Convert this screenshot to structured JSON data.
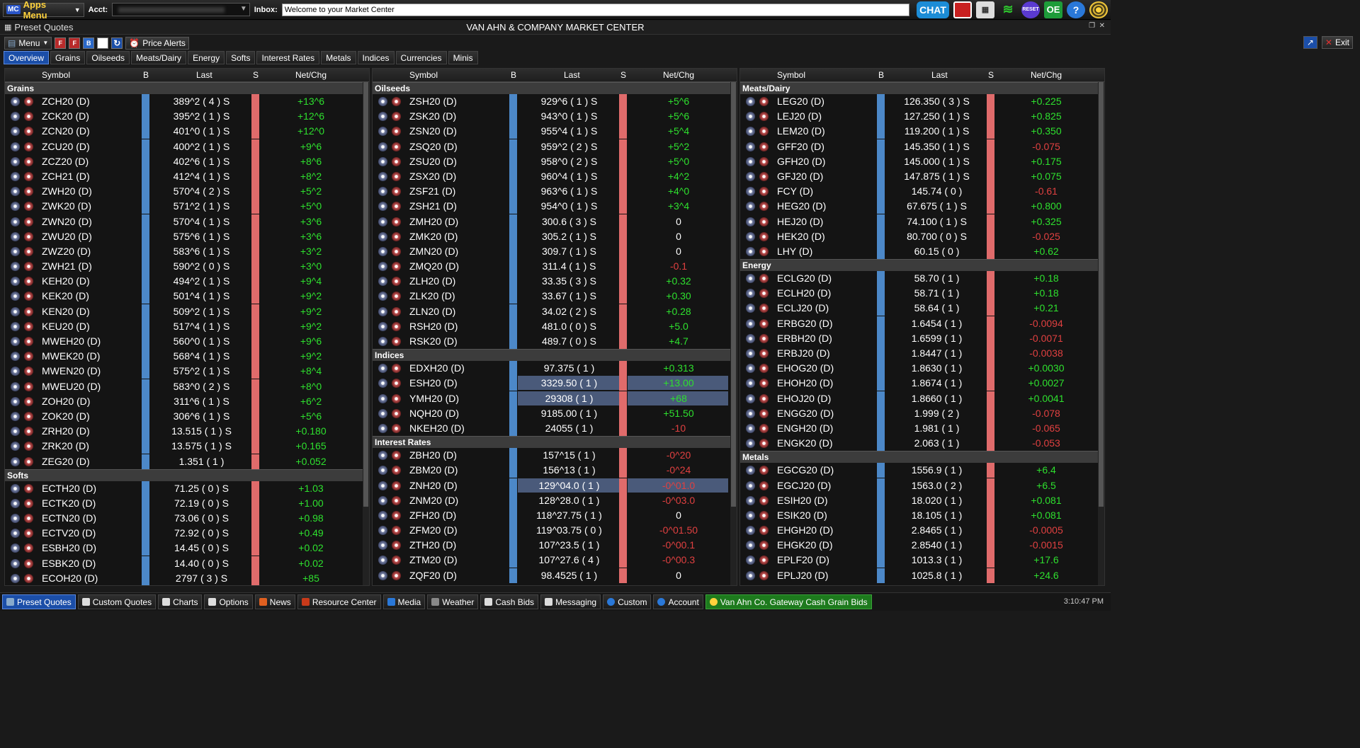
{
  "topbar": {
    "apps_menu": "Apps Menu",
    "apps_prefix": "MC",
    "acct_label": "Acct:",
    "inbox_label": "Inbox:",
    "inbox_value": "Welcome to your Market Center",
    "chat": "CHAT",
    "oe": "OE"
  },
  "window": {
    "name": "Preset Quotes",
    "title": "VAN AHN & COMPANY MARKET CENTER"
  },
  "toolbar": {
    "menu": "Menu",
    "price_alerts": "Price Alerts",
    "exit": "Exit",
    "f1": "F",
    "f2": "F",
    "b": "B"
  },
  "tabs": [
    "Overview",
    "Grains",
    "Oilseeds",
    "Meats/Dairy",
    "Energy",
    "Softs",
    "Interest Rates",
    "Metals",
    "Indices",
    "Currencies",
    "Minis"
  ],
  "columns": {
    "symbol": "Symbol",
    "b": "B",
    "last": "Last",
    "s": "S",
    "netchg": "Net/Chg"
  },
  "panels": [
    {
      "sections": [
        {
          "name": "Grains",
          "rows": [
            [
              "ZCH20 (D)",
              "389^2 ( 4 )  S",
              "+13^6",
              "up"
            ],
            [
              "ZCK20 (D)",
              "395^2 ( 1 )  S",
              "+12^6",
              "up"
            ],
            [
              "ZCN20 (D)",
              "401^0 ( 1 )  S",
              "+12^0",
              "up"
            ],
            [
              "ZCU20 (D)",
              "400^2 ( 1 )  S",
              "+9^6",
              "up"
            ],
            [
              "ZCZ20 (D)",
              "402^6 ( 1 )  S",
              "+8^6",
              "up"
            ],
            [
              "ZCH21 (D)",
              "412^4 ( 1 )  S",
              "+8^2",
              "up"
            ],
            [
              "ZWH20 (D)",
              "570^4 ( 2 )  S",
              "+5^2",
              "up"
            ],
            [
              "ZWK20 (D)",
              "571^2 ( 1 )  S",
              "+5^0",
              "up"
            ],
            [
              "ZWN20 (D)",
              "570^4 ( 1 )  S",
              "+3^6",
              "up"
            ],
            [
              "ZWU20 (D)",
              "575^6 ( 1 )  S",
              "+3^6",
              "up"
            ],
            [
              "ZWZ20 (D)",
              "583^6 ( 1 )  S",
              "+3^2",
              "up"
            ],
            [
              "ZWH21 (D)",
              "590^2 ( 0 )  S",
              "+3^0",
              "up"
            ],
            [
              "KEH20 (D)",
              "494^2 ( 1 )  S",
              "+9^4",
              "up"
            ],
            [
              "KEK20 (D)",
              "501^4 ( 1 )  S",
              "+9^2",
              "up"
            ],
            [
              "KEN20 (D)",
              "509^2 ( 1 )  S",
              "+9^2",
              "up"
            ],
            [
              "KEU20 (D)",
              "517^4 ( 1 )  S",
              "+9^2",
              "up"
            ],
            [
              "MWEH20 (D)",
              "560^0 ( 1 )  S",
              "+9^6",
              "up"
            ],
            [
              "MWEK20 (D)",
              "568^4 ( 1 )  S",
              "+9^2",
              "up"
            ],
            [
              "MWEN20 (D)",
              "575^2 ( 1 )  S",
              "+8^4",
              "up"
            ],
            [
              "MWEU20 (D)",
              "583^0 ( 2 )  S",
              "+8^0",
              "up"
            ],
            [
              "ZOH20 (D)",
              "311^6 ( 1 )  S",
              "+6^2",
              "up"
            ],
            [
              "ZOK20 (D)",
              "306^6 ( 1 )  S",
              "+5^6",
              "up"
            ],
            [
              "ZRH20 (D)",
              "13.515 ( 1 )  S",
              "+0.180",
              "up"
            ],
            [
              "ZRK20 (D)",
              "13.575 ( 1 )  S",
              "+0.165",
              "up"
            ],
            [
              "ZEG20 (D)",
              "1.351 ( 1 )",
              "+0.052",
              "up"
            ]
          ]
        },
        {
          "name": "Softs",
          "rows": [
            [
              "ECTH20 (D)",
              "71.25 ( 0 )  S",
              "+1.03",
              "up"
            ],
            [
              "ECTK20 (D)",
              "72.19 ( 0 )  S",
              "+1.00",
              "up"
            ],
            [
              "ECTN20 (D)",
              "73.06 ( 0 )  S",
              "+0.98",
              "up"
            ],
            [
              "ECTV20 (D)",
              "72.92 ( 0 )  S",
              "+0.49",
              "up"
            ],
            [
              "ESBH20 (D)",
              "14.45 ( 0 )  S",
              "+0.02",
              "up"
            ],
            [
              "ESBK20 (D)",
              "14.40 ( 0 )  S",
              "+0.02",
              "up"
            ],
            [
              "ECOH20 (D)",
              "2797 ( 3 )  S",
              "+85",
              "up"
            ]
          ]
        }
      ]
    },
    {
      "sections": [
        {
          "name": "Oilseeds",
          "rows": [
            [
              "ZSH20 (D)",
              "929^6 ( 1 )  S",
              "+5^6",
              "up"
            ],
            [
              "ZSK20 (D)",
              "943^0 ( 1 )  S",
              "+5^6",
              "up"
            ],
            [
              "ZSN20 (D)",
              "955^4 ( 1 )  S",
              "+5^4",
              "up"
            ],
            [
              "ZSQ20 (D)",
              "959^2 ( 2 )  S",
              "+5^2",
              "up"
            ],
            [
              "ZSU20 (D)",
              "958^0 ( 2 )  S",
              "+5^0",
              "up"
            ],
            [
              "ZSX20 (D)",
              "960^4 ( 1 )  S",
              "+4^2",
              "up"
            ],
            [
              "ZSF21 (D)",
              "963^6 ( 1 )  S",
              "+4^0",
              "up"
            ],
            [
              "ZSH21 (D)",
              "954^0 ( 1 )  S",
              "+3^4",
              "up"
            ],
            [
              "ZMH20 (D)",
              "300.6 ( 3 )  S",
              "0",
              "nc"
            ],
            [
              "ZMK20 (D)",
              "305.2 ( 1 )  S",
              "0",
              "nc"
            ],
            [
              "ZMN20 (D)",
              "309.7 ( 1 )  S",
              "0",
              "nc"
            ],
            [
              "ZMQ20 (D)",
              "311.4 ( 1 )  S",
              "-0.1",
              "dn"
            ],
            [
              "ZLH20 (D)",
              "33.35 ( 3 )  S",
              "+0.32",
              "up"
            ],
            [
              "ZLK20 (D)",
              "33.67 ( 1 )  S",
              "+0.30",
              "up"
            ],
            [
              "ZLN20 (D)",
              "34.02 ( 2 )  S",
              "+0.28",
              "up"
            ],
            [
              "RSH20 (D)",
              "481.0 ( 0 )  S",
              "+5.0",
              "up"
            ],
            [
              "RSK20 (D)",
              "489.7 ( 0 )  S",
              "+4.7",
              "up"
            ]
          ]
        },
        {
          "name": "Indices",
          "rows": [
            [
              "EDXH20 (D)",
              "97.375 ( 1 )",
              "+0.313",
              "up"
            ],
            [
              "ESH20 (D)",
              "3329.50 ( 1 )",
              "+13.00",
              "up",
              "hl"
            ],
            [
              "YMH20 (D)",
              "29308 ( 1 )",
              "+68",
              "up",
              "hl"
            ],
            [
              "NQH20 (D)",
              "9185.00 ( 1 )",
              "+51.50",
              "up"
            ],
            [
              "NKEH20 (D)",
              "24055 ( 1 )",
              "-10",
              "dn"
            ]
          ]
        },
        {
          "name": "Interest Rates",
          "rows": [
            [
              "ZBH20 (D)",
              "157^15 ( 1 )",
              "-0^20",
              "dn"
            ],
            [
              "ZBM20 (D)",
              "156^13 ( 1 )",
              "-0^24",
              "dn"
            ],
            [
              "ZNH20 (D)",
              "129^04.0 ( 1 )",
              "-0^01.0",
              "dn",
              "hl"
            ],
            [
              "ZNM20 (D)",
              "128^28.0 ( 1 )",
              "-0^03.0",
              "dn"
            ],
            [
              "ZFH20 (D)",
              "118^27.75 ( 1 )",
              "0",
              "nc"
            ],
            [
              "ZFM20 (D)",
              "119^03.75 ( 0 )",
              "-0^01.50",
              "dn"
            ],
            [
              "ZTH20 (D)",
              "107^23.5 ( 1 )",
              "-0^00.1",
              "dn"
            ],
            [
              "ZTM20 (D)",
              "107^27.6 ( 4 )",
              "-0^00.3",
              "dn"
            ],
            [
              "ZQF20 (D)",
              "98.4525 ( 1 )",
              "0",
              "nc"
            ]
          ]
        }
      ]
    },
    {
      "sections": [
        {
          "name": "Meats/Dairy",
          "rows": [
            [
              "LEG20 (D)",
              "126.350 ( 3 )  S",
              "+0.225",
              "up"
            ],
            [
              "LEJ20 (D)",
              "127.250 ( 1 )  S",
              "+0.825",
              "up"
            ],
            [
              "LEM20 (D)",
              "119.200 ( 1 )  S",
              "+0.350",
              "up"
            ],
            [
              "GFF20 (D)",
              "145.350 ( 1 )  S",
              "-0.075",
              "dn"
            ],
            [
              "GFH20 (D)",
              "145.000 ( 1 )  S",
              "+0.175",
              "up"
            ],
            [
              "GFJ20 (D)",
              "147.875 ( 1 )  S",
              "+0.075",
              "up"
            ],
            [
              "FCY (D)",
              "145.74 ( 0 )",
              "-0.61",
              "dn"
            ],
            [
              "HEG20 (D)",
              "67.675 ( 1 )  S",
              "+0.800",
              "up"
            ],
            [
              "HEJ20 (D)",
              "74.100 ( 1 )  S",
              "+0.325",
              "up"
            ],
            [
              "HEK20 (D)",
              "80.700 ( 0 )  S",
              "-0.025",
              "dn"
            ],
            [
              "LHY (D)",
              "60.15 ( 0 )",
              "+0.62",
              "up"
            ]
          ]
        },
        {
          "name": "Energy",
          "rows": [
            [
              "ECLG20 (D)",
              "58.70 ( 1 )",
              "+0.18",
              "up"
            ],
            [
              "ECLH20 (D)",
              "58.71 ( 1 )",
              "+0.18",
              "up"
            ],
            [
              "ECLJ20 (D)",
              "58.64 ( 1 )",
              "+0.21",
              "up"
            ],
            [
              "ERBG20 (D)",
              "1.6454 ( 1 )",
              "-0.0094",
              "dn"
            ],
            [
              "ERBH20 (D)",
              "1.6599 ( 1 )",
              "-0.0071",
              "dn"
            ],
            [
              "ERBJ20 (D)",
              "1.8447 ( 1 )",
              "-0.0038",
              "dn"
            ],
            [
              "EHOG20 (D)",
              "1.8630 ( 1 )",
              "+0.0030",
              "up"
            ],
            [
              "EHOH20 (D)",
              "1.8674 ( 1 )",
              "+0.0027",
              "up"
            ],
            [
              "EHOJ20 (D)",
              "1.8660 ( 1 )",
              "+0.0041",
              "up"
            ],
            [
              "ENGG20 (D)",
              "1.999 ( 2 )",
              "-0.078",
              "dn"
            ],
            [
              "ENGH20 (D)",
              "1.981 ( 1 )",
              "-0.065",
              "dn"
            ],
            [
              "ENGK20 (D)",
              "2.063 ( 1 )",
              "-0.053",
              "dn"
            ]
          ]
        },
        {
          "name": "Metals",
          "rows": [
            [
              "EGCG20 (D)",
              "1556.9 ( 1 )",
              "+6.4",
              "up"
            ],
            [
              "EGCJ20 (D)",
              "1563.0 ( 2 )",
              "+6.5",
              "up"
            ],
            [
              "ESIH20 (D)",
              "18.020 ( 1 )",
              "+0.081",
              "up"
            ],
            [
              "ESIK20 (D)",
              "18.105 ( 1 )",
              "+0.081",
              "up"
            ],
            [
              "EHGH20 (D)",
              "2.8465 ( 1 )",
              "-0.0005",
              "dn"
            ],
            [
              "EHGK20 (D)",
              "2.8540 ( 1 )",
              "-0.0015",
              "dn"
            ],
            [
              "EPLF20 (D)",
              "1013.3 ( 1 )",
              "+17.6",
              "up"
            ],
            [
              "EPLJ20 (D)",
              "1025.8 ( 1 )",
              "+24.6",
              "up"
            ]
          ]
        }
      ]
    }
  ],
  "taskbar": [
    "Preset Quotes",
    "Custom Quotes",
    "Charts",
    "Options",
    "News",
    "Resource Center",
    "Media",
    "Weather",
    "Cash Bids",
    "Messaging",
    "Custom",
    "Account",
    "Van Ahn Co. Gateway Cash Grain Bids"
  ],
  "clock": "3:10:47 PM",
  "colors": {
    "up": "#2ee02e",
    "down": "#e04040",
    "accent": "#1b4ea8"
  }
}
